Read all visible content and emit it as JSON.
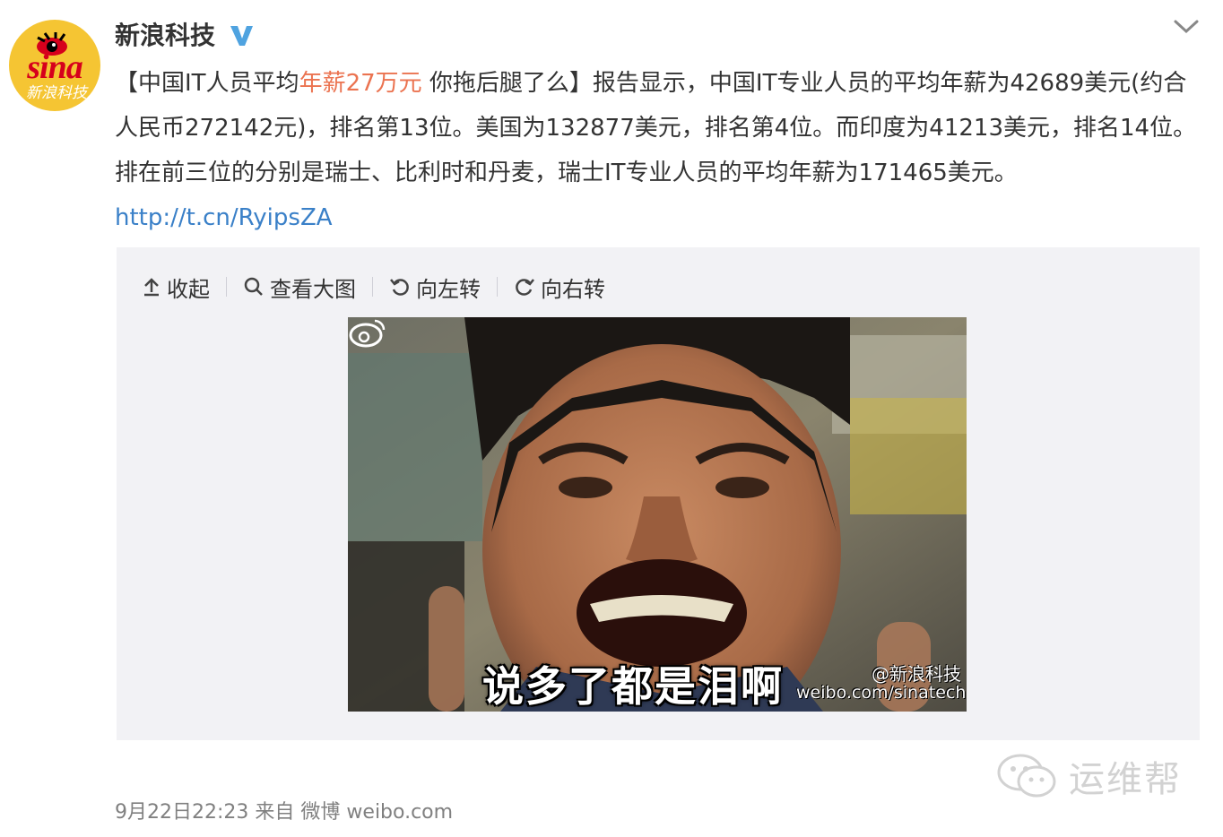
{
  "account": {
    "name": "新浪科技",
    "avatar_logo": "sina",
    "avatar_sub": "新浪科技",
    "verified_icon": "verified-v-icon"
  },
  "post": {
    "text_before": "【中国IT人员平均",
    "text_highlight": "年薪27万元",
    "text_after": " 你拖后腿了么】报告显示，中国IT专业人员的平均年薪为42689美元(约合人民币272142元)，排名第13位。美国为132877美元，排名第4位。而印度为41213美元，排名14位。排在前三位的分别是瑞士、比利时和丹麦，瑞士IT专业人员的平均年薪为171465美元。",
    "link": "http://t.cn/RyipsZA",
    "highlight_color": "#eb7350",
    "link_color": "#3a80c8"
  },
  "media_toolbar": {
    "collapse": "收起",
    "view_large": "查看大图",
    "rotate_left": "向左转",
    "rotate_right": "向右转"
  },
  "image": {
    "caption": "说多了都是泪啊",
    "watermark_name": "@新浪科技",
    "watermark_url": "weibo.com/sinatech"
  },
  "meta": {
    "time": "9月22日22:23",
    "from_label": "来自",
    "source": "微博 weibo.com"
  },
  "brand_watermark": "运维帮"
}
